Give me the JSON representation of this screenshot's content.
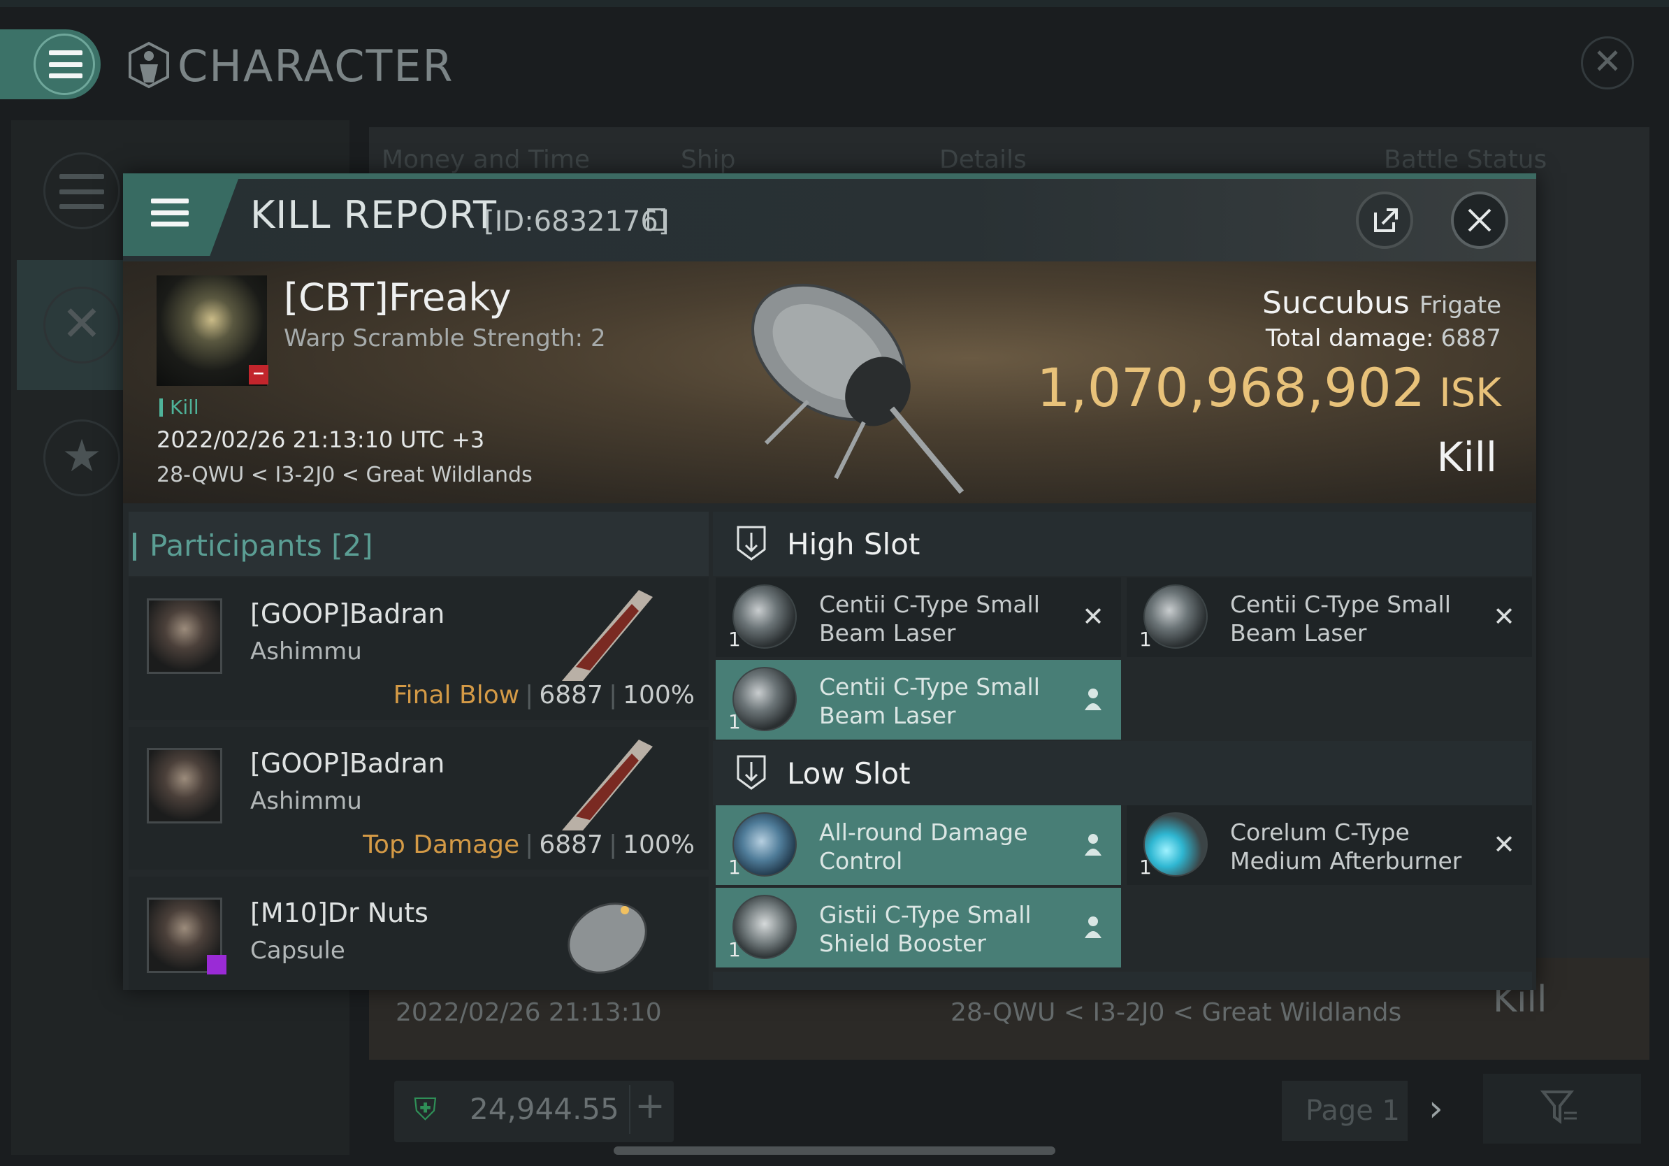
{
  "app": {
    "title": "CHARACTER",
    "menu_icon": "hamburger-icon",
    "close_icon": "close-icon"
  },
  "background": {
    "columns": [
      "Money and Time",
      "Ship",
      "Details",
      "Battle Status"
    ],
    "row": {
      "date": "2022/02/26  21:13:10",
      "location": "28-QWU < I3-2J0 < Great Wildlands",
      "result": "Kill"
    },
    "wallet": {
      "value": "24,944.55",
      "plus": "+"
    },
    "pagination": {
      "label": "Page 1",
      "next": "›"
    }
  },
  "report": {
    "title": "KILL REPORT",
    "id": "[ID:6832176]",
    "victim": {
      "name": "[CBT]Freaky",
      "sub": "Warp Scramble Strength: 2",
      "tag": "Kill",
      "date": "2022/02/26 21:13:10 UTC +3",
      "location": "28-QWU < I3-2J0 < Great Wildlands"
    },
    "ship": {
      "name": "Succubus",
      "class": "Frigate",
      "total_damage_label": "Total damage:",
      "total_damage": "6887",
      "isk_value": "1,070,968,902",
      "isk_unit": "ISK",
      "result": "Kill"
    },
    "participants": {
      "title": "Participants",
      "count": "[2]",
      "rows": [
        {
          "name": "[GOOP]Badran",
          "ship": "Ashimmu",
          "label": "Final Blow",
          "damage": "6887",
          "percent": "100%"
        },
        {
          "name": "[GOOP]Badran",
          "ship": "Ashimmu",
          "label": "Top Damage",
          "damage": "6887",
          "percent": "100%"
        },
        {
          "name": "[M10]Dr Nuts",
          "ship": "Capsule",
          "label": "",
          "damage": "",
          "percent": ""
        }
      ]
    },
    "high_slot": {
      "title": "High Slot",
      "modules": [
        {
          "name": "Centii C-Type Small Beam Laser",
          "qty": "1",
          "status": "✕",
          "status_name": "destroyed-icon"
        },
        {
          "name": "Centii C-Type Small Beam Laser",
          "qty": "1",
          "status": "✕",
          "status_name": "destroyed-icon"
        },
        {
          "name": "Centii C-Type Small Beam Laser",
          "qty": "1",
          "status": "person",
          "status_name": "dropped-icon"
        }
      ]
    },
    "low_slot": {
      "title": "Low Slot",
      "modules": [
        {
          "name": "All-round Damage Control",
          "qty": "1",
          "status": "person",
          "status_name": "dropped-icon"
        },
        {
          "name": "Corelum C-Type Medium Afterburner",
          "qty": "1",
          "status": "✕",
          "status_name": "destroyed-icon"
        },
        {
          "name": "Gistii C-Type Small Shield Booster",
          "qty": "1",
          "status": "person",
          "status_name": "dropped-icon"
        }
      ]
    },
    "colors": {
      "accent": "#3c7268",
      "isk": "#e8c27a",
      "final_blow": "#d49a46",
      "kill_tag": "#4fb39a"
    }
  }
}
